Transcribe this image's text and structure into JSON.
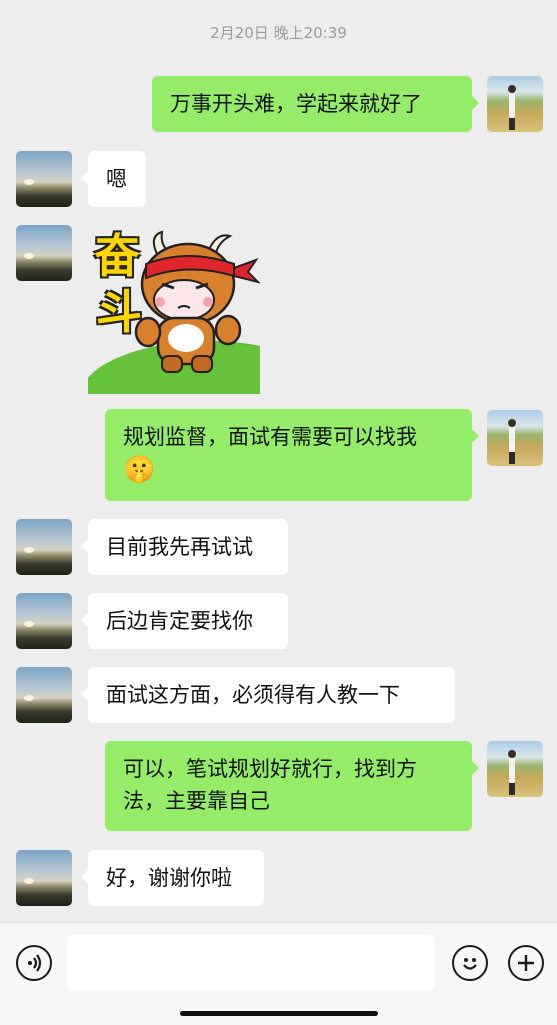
{
  "header": {
    "timestamp": "2月20日 晚上20:39"
  },
  "messages": [
    {
      "sender": "self",
      "text": "万事开头难，学起来就好了"
    },
    {
      "sender": "other",
      "text": "嗯"
    },
    {
      "sender": "other",
      "type": "sticker",
      "sticker_text": [
        "奋",
        "斗"
      ]
    },
    {
      "sender": "self",
      "text": "规划监督，面试有需要可以找我",
      "emoji": "🤫"
    },
    {
      "sender": "other",
      "text": "目前我先再试试"
    },
    {
      "sender": "other",
      "text": "后边肯定要找你"
    },
    {
      "sender": "other",
      "text": "面试这方面，必须得有人教一下"
    },
    {
      "sender": "self",
      "text": "可以，笔试规划好就行，找到方法，主要靠自己"
    },
    {
      "sender": "other",
      "text": "好，谢谢你啦"
    }
  ],
  "input_bar": {
    "voice_icon": "voice-icon",
    "emoji_icon": "emoji-icon",
    "plus_icon": "plus-icon",
    "input_value": ""
  },
  "colors": {
    "background": "#ededed",
    "self_bubble": "#95ec69",
    "other_bubble": "#ffffff"
  }
}
